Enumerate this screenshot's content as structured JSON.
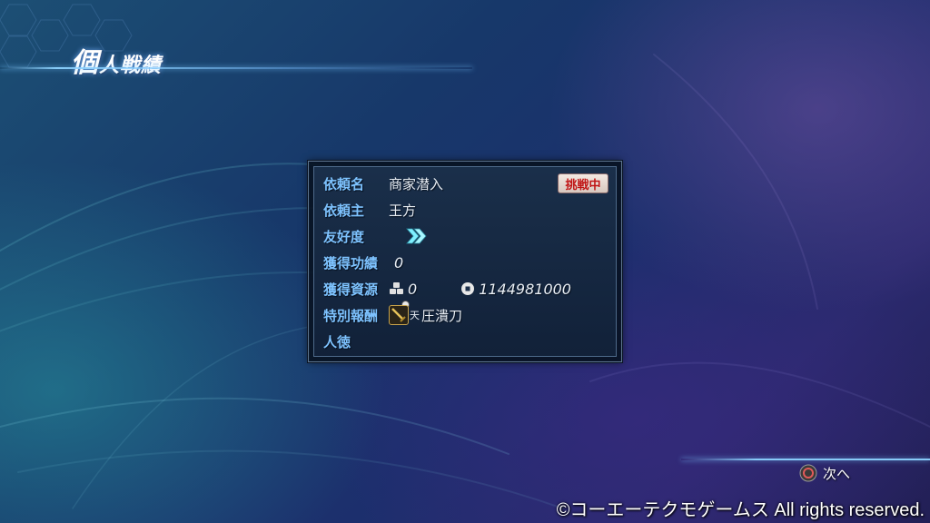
{
  "header": {
    "title_big": "個",
    "title_rest": "人戦績"
  },
  "request": {
    "status": "挑戦中",
    "rows": [
      {
        "label": "依頼名",
        "value": "商家潜入"
      },
      {
        "label": "依頼主",
        "value": "王方"
      },
      {
        "label": "友好度",
        "value": ""
      },
      {
        "label": "獲得功績",
        "value": "0"
      },
      {
        "label": "獲得資源",
        "resource": "0",
        "gold": "1144981000"
      },
      {
        "label": "特別報酬",
        "rank": "天",
        "item": "圧潰刀"
      },
      {
        "label": "人徳",
        "value": ""
      }
    ]
  },
  "footer": {
    "next_label": "次へ",
    "copyright": "©コーエーテクモゲームス All rights reserved."
  },
  "colors": {
    "label": "#7ec3ff",
    "status_text": "#c01414",
    "chevron": "#7ff0ff",
    "accent_line": "#8cd2ff"
  },
  "icons": {
    "friendship": "double-chevron-icon",
    "resource": "resource-blocks-icon",
    "gold": "coin-icon",
    "reward": "sword-icon",
    "next": "circle-button-icon"
  }
}
